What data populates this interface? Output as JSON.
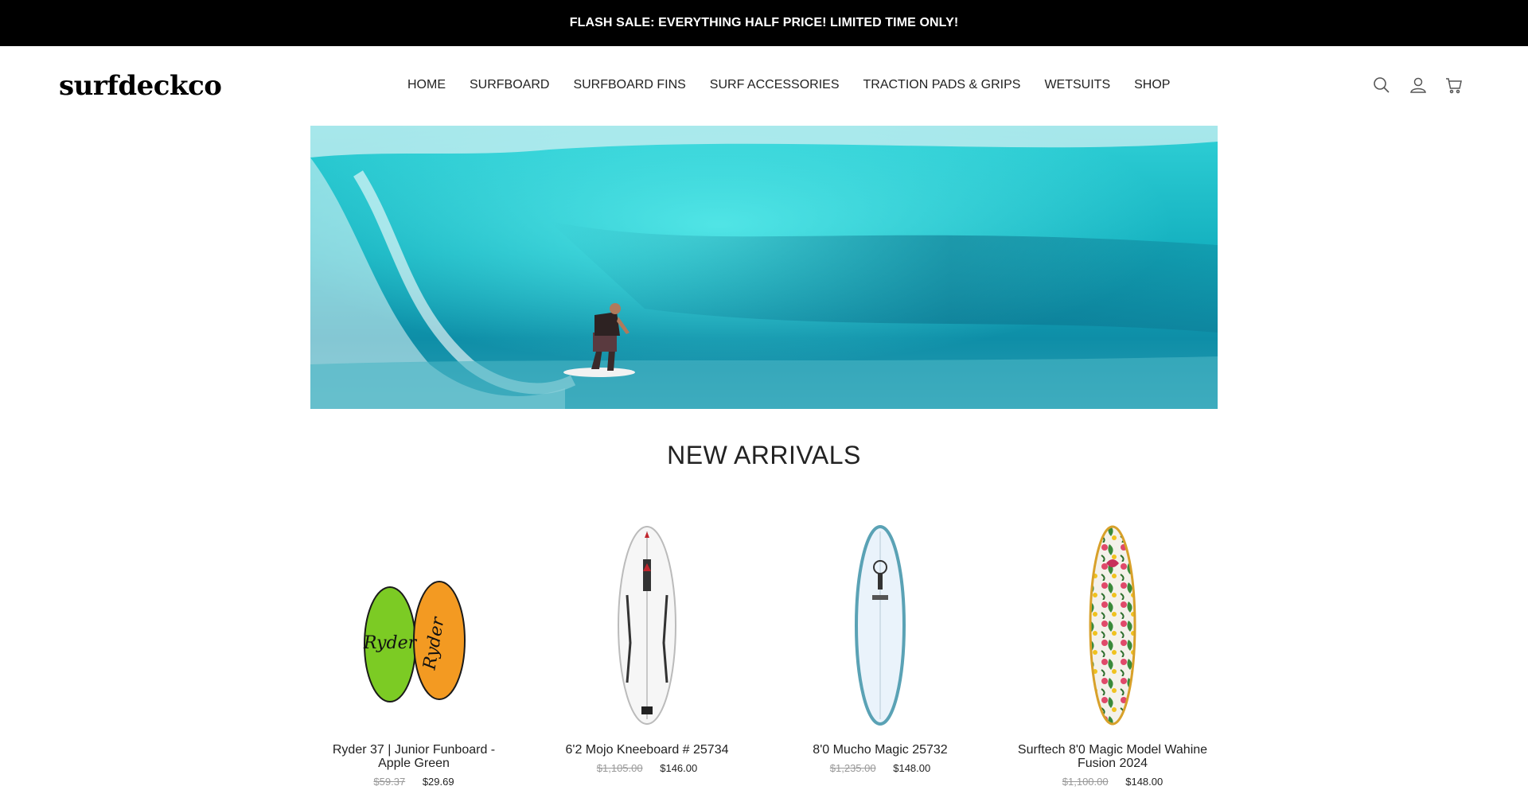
{
  "announcement": "FLASH SALE: EVERYTHING HALF PRICE! LIMITED TIME ONLY!",
  "logo": "surfdeckco",
  "nav": [
    "HOME",
    "SURFBOARD",
    "SURFBOARD FINS",
    "SURF ACCESSORIES",
    "TRACTION PADS & GRIPS",
    "WETSUITS",
    "SHOP"
  ],
  "icons": {
    "search": "search-icon",
    "account": "account-icon",
    "cart": "cart-icon"
  },
  "section_title": "NEW ARRIVALS",
  "products": [
    {
      "name": "Ryder 37 | Junior Funboard - Apple Green",
      "old_price": "$59.37",
      "price": "$29.69"
    },
    {
      "name": "6'2 Mojo Kneeboard # 25734",
      "old_price": "$1,105.00",
      "price": "$146.00"
    },
    {
      "name": "8'0 Mucho Magic 25732",
      "old_price": "$1,235.00",
      "price": "$148.00"
    },
    {
      "name": "Surftech 8'0 Magic Model Wahine Fusion 2024",
      "old_price": "$1,100.00",
      "price": "$148.00"
    }
  ],
  "colors": {
    "announcement_bg": "#000000",
    "wave": "#1fb8c4",
    "price_old": "#999999"
  }
}
